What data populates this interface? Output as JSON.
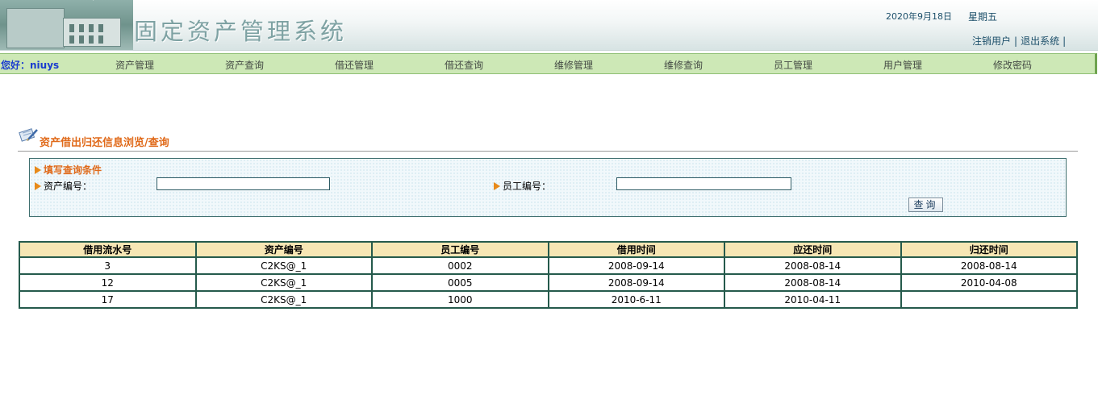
{
  "header": {
    "system_title": "固定资产管理系统",
    "date": "2020年9月18日",
    "weekday": "星期五",
    "links": [
      "注销用户",
      "退出系统"
    ],
    "separator": "|"
  },
  "nav": {
    "greeting": "您好：niuys",
    "items": [
      "资产管理",
      "资产查询",
      "借还管理",
      "借还查询",
      "维修管理",
      "维修查询",
      "员工管理",
      "用户管理",
      "修改密码"
    ]
  },
  "section": {
    "title": "资产借出归还信息浏览/查询"
  },
  "query": {
    "title": "填写查询条件",
    "asset_label": "资产编号：",
    "asset_value": "",
    "employee_label": "员工编号：",
    "employee_value": "",
    "button_label": "查询"
  },
  "table": {
    "headers": [
      "借用流水号",
      "资产编号",
      "员工编号",
      "借用时间",
      "应还时间",
      "归还时间"
    ],
    "rows": [
      [
        "3",
        "C2KS@_1",
        "0002",
        "2008-09-14",
        "2008-08-14",
        "2008-08-14"
      ],
      [
        "12",
        "C2KS@_1",
        "0005",
        "2008-09-14",
        "2008-08-14",
        "2010-04-08"
      ],
      [
        "17",
        "C2KS@_1",
        "1000",
        "2010-6-11",
        "2010-04-11",
        ""
      ]
    ]
  },
  "colors": {
    "nav_bg": "#cde8b6",
    "accent_orange": "#e06a1a",
    "table_border": "#255a4c",
    "table_header_bg": "#f6e6b4"
  }
}
